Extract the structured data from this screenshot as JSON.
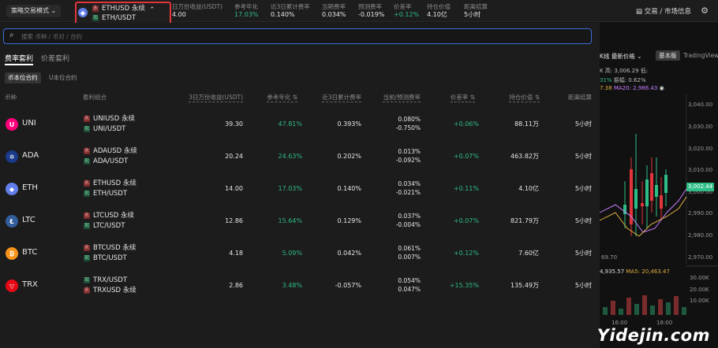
{
  "topbar": {
    "mode_label": "策略交易模式",
    "pair": {
      "line1": "ETHUSD 永续",
      "line2": "ETH/USDT"
    },
    "stats": [
      {
        "label": "日万份收益(USDT)",
        "value": "4.00",
        "green": false
      },
      {
        "label": "参考年化",
        "value": "17.03%",
        "green": true
      },
      {
        "label": "近3日累计费率",
        "value": "0.140%",
        "green": false
      },
      {
        "label": "当期费率",
        "value": "0.034%",
        "green": false
      },
      {
        "label": "预测费率",
        "value": "-0.019%",
        "green": false
      },
      {
        "label": "价差率",
        "value": "+0.12%",
        "green": true
      },
      {
        "label": "持仓价值",
        "value": "4.10亿",
        "green": false
      },
      {
        "label": "距离结算",
        "value": "5小时",
        "green": false
      }
    ],
    "right_link": "交易 / 市场信息"
  },
  "search": {
    "placeholder": "搜索 币种 / 币对 / 合约"
  },
  "tabs": [
    "费率套利",
    "价差套利"
  ],
  "subtabs": [
    "币本位合约",
    "U本位合约"
  ],
  "columns": [
    "币种",
    "套利组合",
    "3日万份收益(USDT)",
    "参考年化",
    "近3日累计费率",
    "当前/预测费率",
    "价差率",
    "持仓价值",
    "距离结算"
  ],
  "rows": [
    {
      "coin": "UNI",
      "icon_color": "#ff007a",
      "icon": "unicorn-icon",
      "leg1": "UNIUSD 永续",
      "leg2": "UNI/USDT",
      "earn": "39.30",
      "apy": "47.81%",
      "cum3": "0.393%",
      "cur": "0.080%",
      "pred": "-0.750%",
      "spread": "+0.06%",
      "oi": "88.11万",
      "settle": "5小时"
    },
    {
      "coin": "ADA",
      "icon_color": "#1a3a8a",
      "icon": "ada-icon",
      "leg1": "ADAUSD 永续",
      "leg2": "ADA/USDT",
      "earn": "20.24",
      "apy": "24.63%",
      "cum3": "0.202%",
      "cur": "0.013%",
      "pred": "-0.092%",
      "spread": "+0.07%",
      "oi": "463.82万",
      "settle": "5小时"
    },
    {
      "coin": "ETH",
      "icon_color": "#627eea",
      "icon": "eth-icon",
      "leg1": "ETHUSD 永续",
      "leg2": "ETH/USDT",
      "earn": "14.00",
      "apy": "17.03%",
      "cum3": "0.140%",
      "cur": "0.034%",
      "pred": "-0.021%",
      "spread": "+0.11%",
      "oi": "4.10亿",
      "settle": "5小时"
    },
    {
      "coin": "LTC",
      "icon_color": "#345d9d",
      "icon": "ltc-icon",
      "leg1": "LTCUSD 永续",
      "leg2": "LTC/USDT",
      "earn": "12.86",
      "apy": "15.64%",
      "cum3": "0.129%",
      "cur": "0.037%",
      "pred": "-0.004%",
      "spread": "+0.07%",
      "oi": "821.79万",
      "settle": "5小时"
    },
    {
      "coin": "BTC",
      "icon_color": "#f7931a",
      "icon": "btc-icon",
      "leg1": "BTCUSD 永续",
      "leg2": "BTC/USDT",
      "earn": "4.18",
      "apy": "5.09%",
      "cum3": "0.042%",
      "cur": "0.061%",
      "pred": "0.007%",
      "spread": "+0.12%",
      "oi": "7.60亿",
      "settle": "5小时"
    },
    {
      "coin": "TRX",
      "icon_color": "#e50915",
      "icon": "trx-icon",
      "leg1": "TRX/USDT",
      "leg2": "TRXUSD 永续",
      "earn": "2.86",
      "apy": "3.48%",
      "cum3": "-0.057%",
      "cur": "0.054%",
      "pred": "0.047%",
      "spread": "+15.35%",
      "oi": "135.49万",
      "settle": "5小时"
    }
  ],
  "chart": {
    "header_left": "K线",
    "price_mode": "最新价格",
    "basic_btn": "基本版",
    "tv_btn": "TradingView",
    "high": "高: 3,006.29",
    "low": "低:",
    "pct": "31%",
    "amp": "振幅: 0.62%",
    "ma_a": "7.38",
    "ma20": "MA20: 2,986.43",
    "price_ticks": [
      "3,040.00",
      "3,030.00",
      "3,020.00",
      "3,010.00",
      "3,000.00",
      "2,990.00",
      "2,980.00",
      "2,970.00"
    ],
    "current_price": "3,002.44",
    "low_mark": "69.70",
    "vol_left": "4,935.57",
    "vol_ma5": "MA5: 20,463.47",
    "vol_ticks": [
      "30.00K",
      "20.00K",
      "10.00K"
    ],
    "time_ticks": [
      "16:00",
      "18:00"
    ]
  },
  "watermark": "Yidejin.com"
}
